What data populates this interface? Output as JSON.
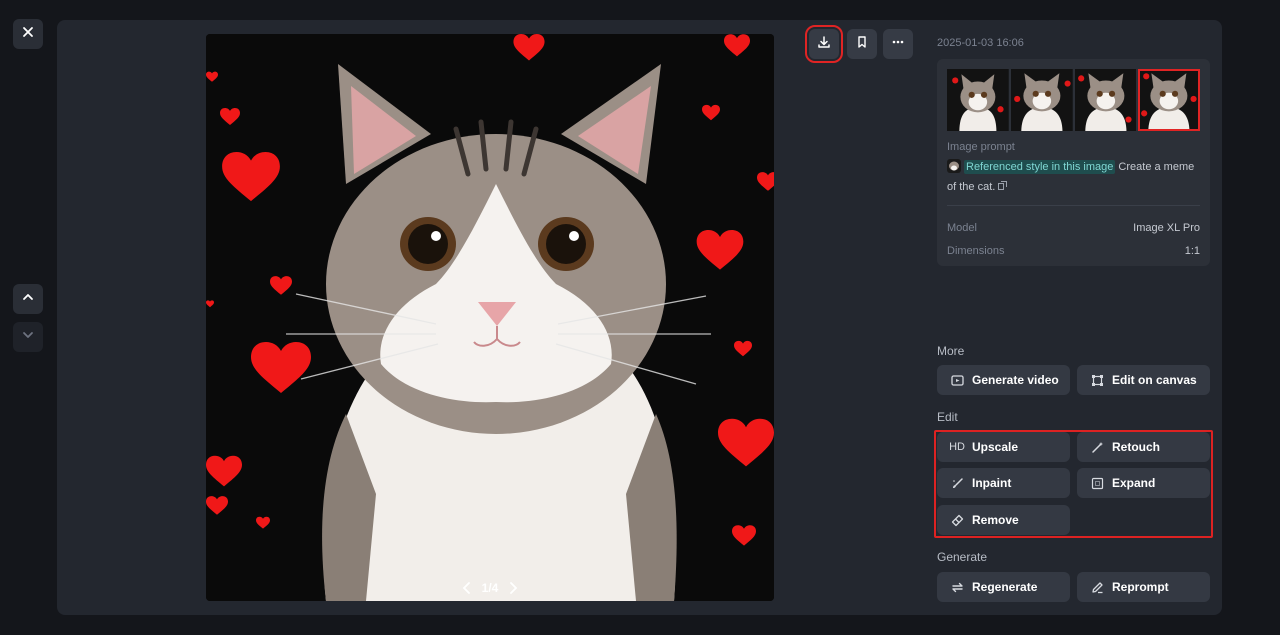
{
  "window": {
    "close_icon": "close-icon"
  },
  "nav": {
    "up_icon": "chevron-up-icon",
    "down_icon": "chevron-down-icon"
  },
  "toolbar": {
    "download_icon": "download-icon",
    "bookmark_icon": "bookmark-icon",
    "more_icon": "more-icon"
  },
  "viewer": {
    "pager_text": "1/4"
  },
  "details": {
    "date": "2025-01-03 16:06",
    "thumbnail_count": 4,
    "active_thumbnail": 4,
    "prompt_label": "Image prompt",
    "prompt_reference": "Referenced style in this image",
    "prompt_text": "Create a meme of the cat.",
    "model_label": "Model",
    "model_value": "Image XL Pro",
    "dimensions_label": "Dimensions",
    "dimensions_value": "1:1"
  },
  "sections": {
    "more": {
      "title": "More",
      "generate_video": "Generate video",
      "edit_on_canvas": "Edit on canvas"
    },
    "edit": {
      "title": "Edit",
      "upscale": "Upscale",
      "upscale_icon_text": "HD",
      "retouch": "Retouch",
      "inpaint": "Inpaint",
      "expand": "Expand",
      "remove": "Remove"
    },
    "generate": {
      "title": "Generate",
      "regenerate": "Regenerate",
      "reprompt": "Reprompt"
    }
  },
  "colors": {
    "highlight": "#e02424",
    "panel": "#23272f",
    "background": "#14161b",
    "chip": "#1f4d4e"
  }
}
